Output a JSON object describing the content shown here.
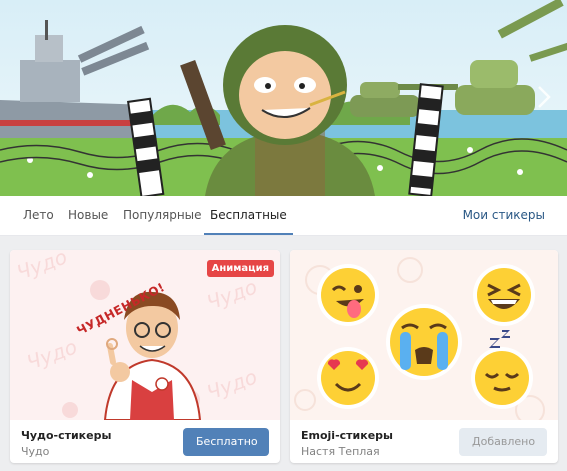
{
  "tabs": [
    {
      "label": "Лето",
      "active": false
    },
    {
      "label": "Новые",
      "active": false
    },
    {
      "label": "Популярные",
      "active": false
    },
    {
      "label": "Бесплатные",
      "active": true
    }
  ],
  "my_stickers_link": "Мои стикеры",
  "cards": [
    {
      "name": "Чудо-стикеры",
      "author": "Чудо",
      "badge": "Анимация",
      "art_caption": "ЧУДНЕНЬКО!",
      "button_label": "Бесплатно",
      "button_state": "primary"
    },
    {
      "name": "Emoji-стикеры",
      "author": "Настя Теплая",
      "button_label": "Добавлено",
      "button_state": "disabled"
    }
  ],
  "colors": {
    "accent": "#5181b8",
    "badge": "#e64646",
    "background": "#edeef0"
  }
}
